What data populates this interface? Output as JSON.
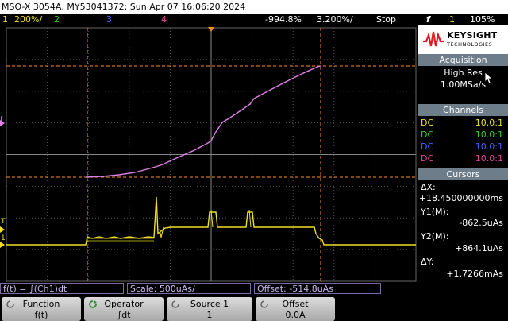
{
  "window": {
    "title": "MSO-X 3054A, MY53041372: Sun Apr 07 16:06:20 2024"
  },
  "status": {
    "ch1_label": "1",
    "ch1_scale": "200%/",
    "ch2_label": "2",
    "ch3_label": "3",
    "ch4_label": "4",
    "time_offset": "-994.8%",
    "time_scale": "3.200%/",
    "run_state": "Stop",
    "trigger_symbol": "f",
    "trigger_channel": "1",
    "trigger_level": "105%"
  },
  "colors": {
    "ch1": "#f0e020",
    "ch2": "#30d030",
    "ch3": "#4060ff",
    "ch4": "#e040a0",
    "math": "#e080e8",
    "cursor": "#ff8c1a"
  },
  "sidebar": {
    "brand": "KEYSIGHT",
    "brand_sub": "TECHNOLOGIES",
    "acquisition": {
      "header": "Acquisition",
      "mode": "High Res",
      "rate": "1.00MSa/s"
    },
    "channels": {
      "header": "Channels",
      "rows": [
        {
          "coupling": "DC",
          "probe": "10.0:1"
        },
        {
          "coupling": "DC",
          "probe": "10.0:1"
        },
        {
          "coupling": "DC",
          "probe": "10.0:1"
        },
        {
          "coupling": "DC",
          "probe": "10.0:1"
        }
      ]
    },
    "cursors": {
      "header": "Cursors",
      "dx_label": "ΔX:",
      "dx_value": "+18.450000000ms",
      "y1_label": "Y1(M):",
      "y1_value": "-862.5uAs",
      "y2_label": "Y2(M):",
      "y2_value": "+864.1uAs",
      "dy_label": "ΔY:",
      "dy_value": "+1.7266mAs"
    }
  },
  "formula": {
    "expression": "f(t) = ∫(Ch1)dt",
    "scale": "Scale: 500uAs/",
    "offset": "Offset: -514.8uAs"
  },
  "softkeys": [
    {
      "title": "Function",
      "value": "f(t)"
    },
    {
      "title": "Operator",
      "value": "∫dt"
    },
    {
      "title": "Source 1",
      "value": "1"
    },
    {
      "title": "Offset",
      "value": "0.0A"
    }
  ]
}
